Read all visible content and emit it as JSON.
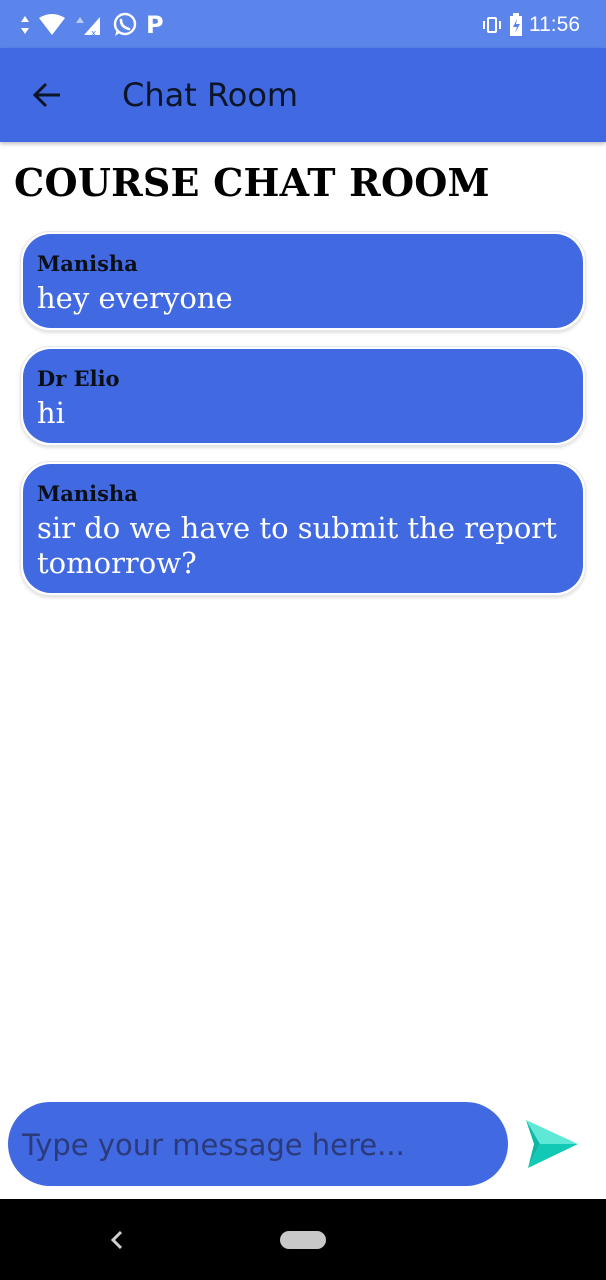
{
  "status_bar": {
    "time": "11:56",
    "icons": [
      "data-arrows-icon",
      "wifi-icon",
      "signal-icon",
      "whatsapp-icon",
      "p-icon",
      "vibrate-icon",
      "battery-icon"
    ],
    "p_label": "P"
  },
  "app_bar": {
    "title": "Chat Room",
    "back_icon": "back-arrow-icon"
  },
  "page": {
    "heading": "COURSE CHAT ROOM"
  },
  "messages": [
    {
      "sender": "Manisha",
      "text": "hey everyone"
    },
    {
      "sender": "Dr Elio",
      "text": "hi"
    },
    {
      "sender": "Manisha",
      "text": "sir do we have to submit the report tomorrow?"
    }
  ],
  "composer": {
    "placeholder": "Type your message here...",
    "value": "",
    "send_icon": "send-icon"
  },
  "nav_bar": {
    "icons": [
      "nav-back-icon",
      "home-pill-icon"
    ]
  },
  "colors": {
    "accent": "#4169e1",
    "status_bar": "#5b85ea",
    "send_teal": "#1fd7c4"
  }
}
